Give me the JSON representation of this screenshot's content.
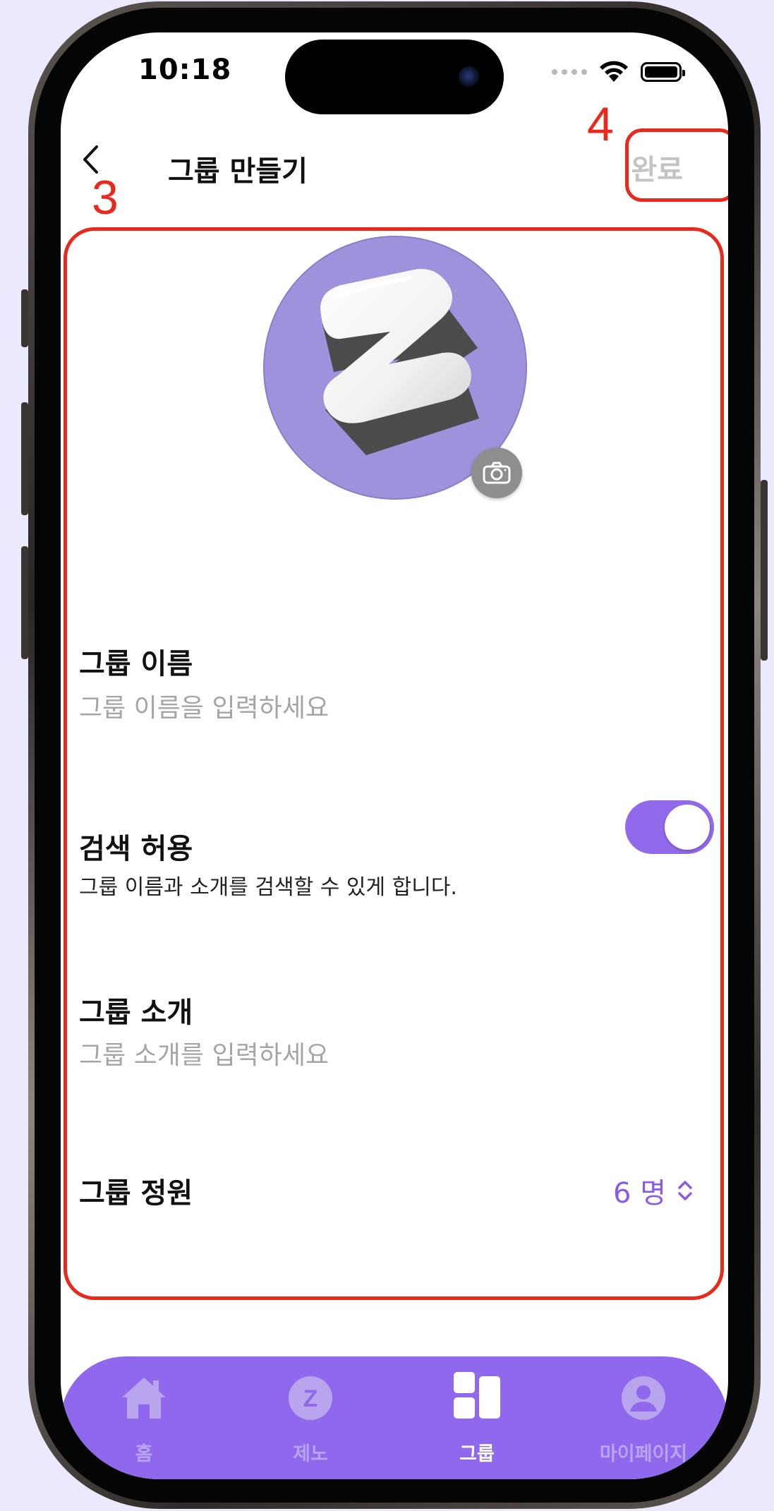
{
  "status_bar": {
    "time": "10:18"
  },
  "nav": {
    "title": "그룹 만들기",
    "done_label": "완료"
  },
  "annotations": {
    "label_3": "3",
    "label_4": "4"
  },
  "form": {
    "group_name": {
      "label": "그룹 이름",
      "placeholder": "그룹 이름을 입력하세요",
      "value": ""
    },
    "search_allow": {
      "label": "검색 허용",
      "description": "그룹 이름과 소개를 검색할 수 있게 합니다.",
      "enabled": true
    },
    "group_intro": {
      "label": "그룹 소개",
      "placeholder": "그룹 소개를 입력하세요",
      "value": ""
    },
    "group_capacity": {
      "label": "그룹 정원",
      "value": "6 명"
    }
  },
  "tabbar": {
    "items": [
      {
        "label": "홈",
        "icon": "home-icon",
        "active": false
      },
      {
        "label": "제노",
        "icon": "z-logo-icon",
        "active": false
      },
      {
        "label": "그룹",
        "icon": "group-grid-icon",
        "active": true
      },
      {
        "label": "마이페이지",
        "icon": "person-icon",
        "active": false
      }
    ]
  },
  "colors": {
    "accent": "#9068ee",
    "toggle_on": "#9269ea",
    "stepper_text": "#8a5ce6",
    "avatar_bg": "#9f91dc",
    "annotation": "#e8291c",
    "placeholder": "#a5a5a5",
    "done_disabled": "#c4c4c4",
    "page_bg": "#ece8fd"
  }
}
